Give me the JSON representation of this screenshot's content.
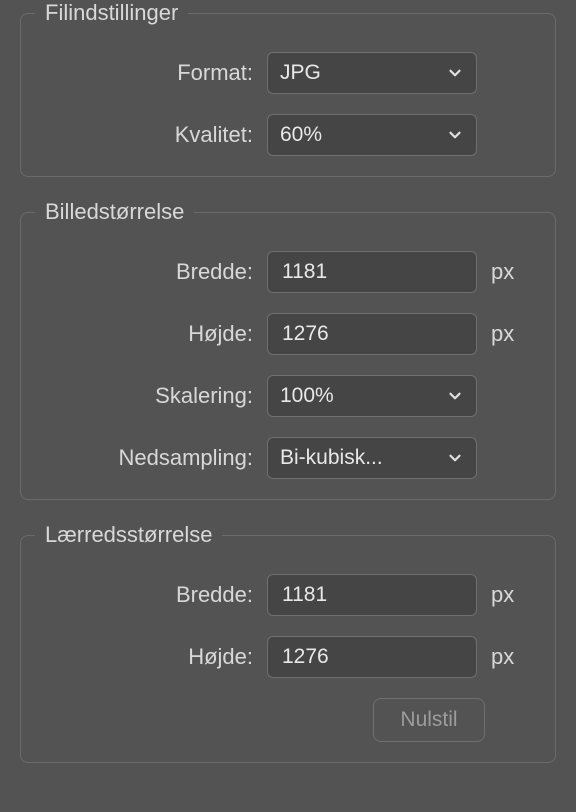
{
  "fileSettings": {
    "legend": "Filindstillinger",
    "format": {
      "label": "Format:",
      "value": "JPG"
    },
    "quality": {
      "label": "Kvalitet:",
      "value": "60%"
    }
  },
  "imageSize": {
    "legend": "Billedstørrelse",
    "width": {
      "label": "Bredde:",
      "value": "1181",
      "unit": "px"
    },
    "height": {
      "label": "Højde:",
      "value": "1276",
      "unit": "px"
    },
    "scale": {
      "label": "Skalering:",
      "value": "100%"
    },
    "resample": {
      "label": "Nedsampling:",
      "value": "Bi-kubisk..."
    }
  },
  "canvasSize": {
    "legend": "Lærredsstørrelse",
    "width": {
      "label": "Bredde:",
      "value": "1181",
      "unit": "px"
    },
    "height": {
      "label": "Højde:",
      "value": "1276",
      "unit": "px"
    },
    "reset": "Nulstil"
  }
}
